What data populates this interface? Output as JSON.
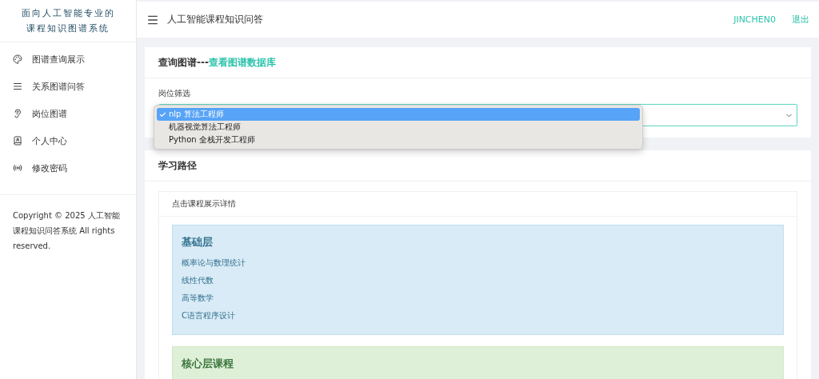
{
  "sidebar": {
    "logo_lines": [
      "面向人工智能专业的",
      "课程知识图谱系统"
    ],
    "items": [
      {
        "label": "图谱查询展示"
      },
      {
        "label": "关系图谱问答"
      },
      {
        "label": "岗位图谱"
      },
      {
        "label": "个人中心"
      },
      {
        "label": "修改密码"
      }
    ],
    "copyright": "Copyright © 2025 人工智能课程知识问答系统 All rights reserved."
  },
  "topbar": {
    "title": "人工智能课程知识问答",
    "user": "JINCHEN0",
    "logout": "退出"
  },
  "query_card": {
    "title": "查询图谱---",
    "link": "查看图谱数据库",
    "filter_label": "岗位筛选",
    "options": [
      {
        "label": "nlp 算法工程师",
        "selected": true
      },
      {
        "label": "机器视觉算法工程师",
        "selected": false
      },
      {
        "label": "Python 全栈开发工程师",
        "selected": false
      }
    ]
  },
  "path_card": {
    "title": "学习路径",
    "hint": "点击课程展示详情",
    "levels": [
      {
        "kind": "basic",
        "title": "基础层",
        "courses": [
          "概率论与数理统计",
          "线性代数",
          "高等数学",
          "C语言程序设计"
        ]
      },
      {
        "kind": "core",
        "title": "核心层课程"
      }
    ]
  }
}
